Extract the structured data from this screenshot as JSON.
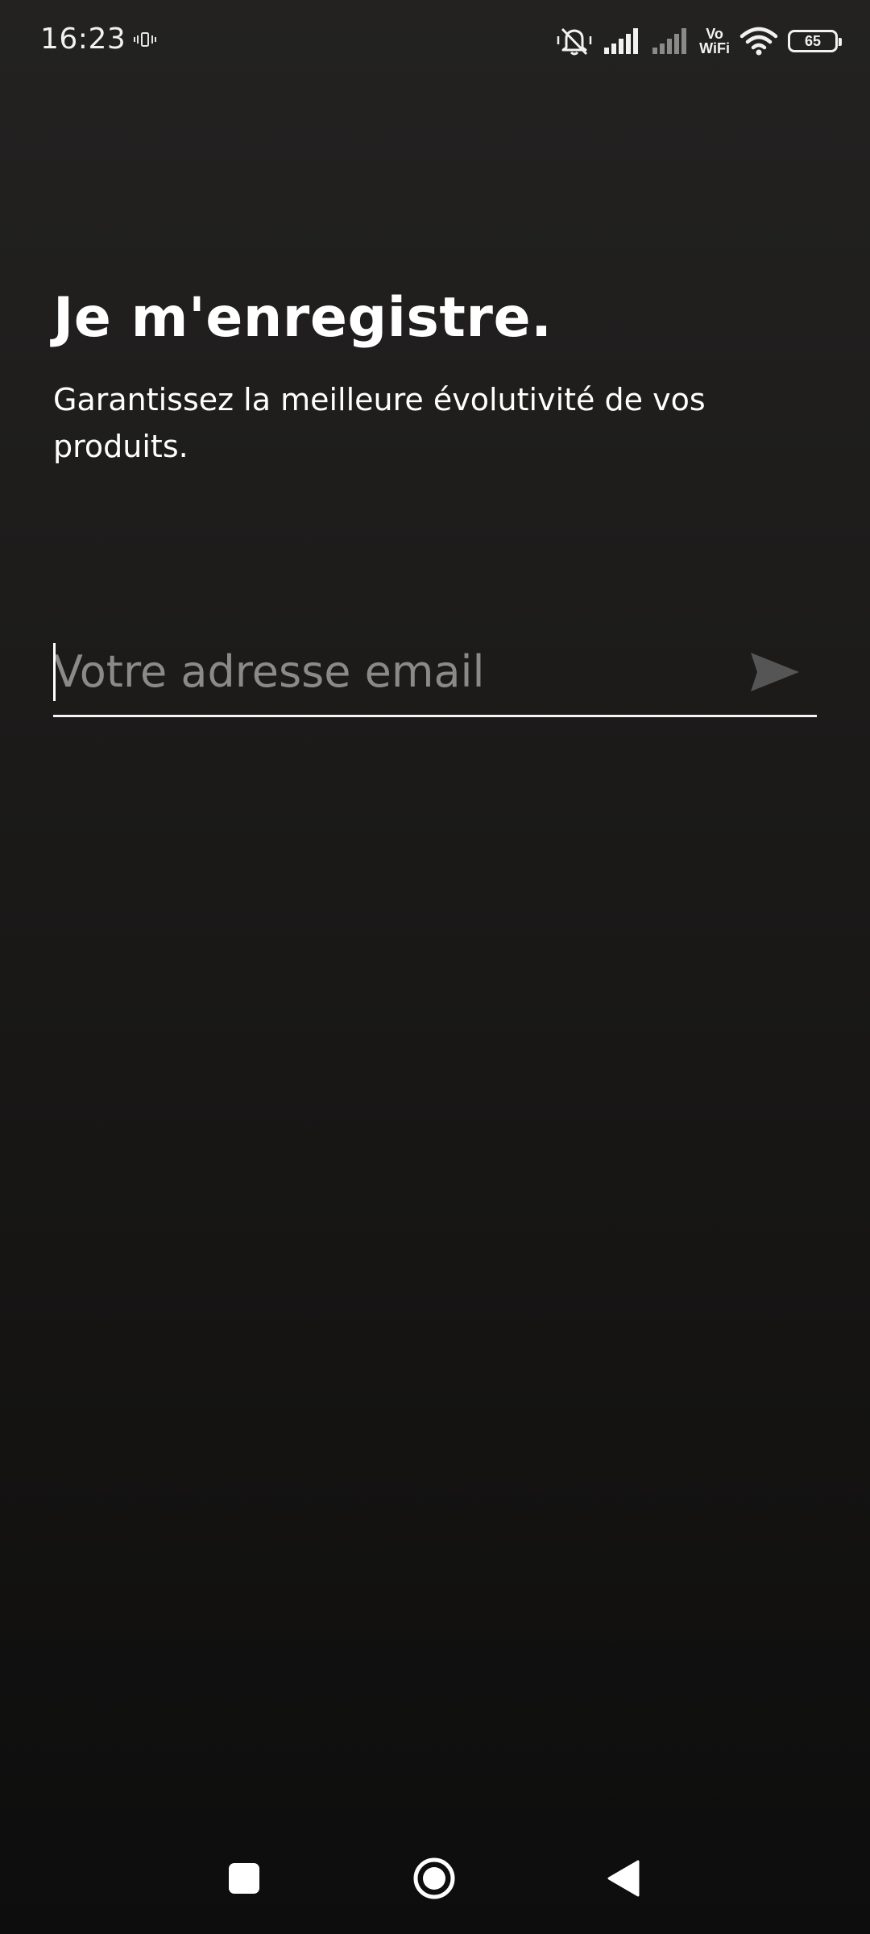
{
  "status_bar": {
    "time": "16:23",
    "battery_level": "65",
    "vowifi_top": "Vo",
    "vowifi_bottom": "WiFi",
    "icons": [
      "vibrate-icon",
      "mute-icon",
      "signal-icon",
      "signal-weak-icon",
      "wifi-icon",
      "battery-icon"
    ]
  },
  "register": {
    "title": "Je m'enregistre.",
    "subtitle": "Garantissez la meilleure évolutivité de vos produits.",
    "email_placeholder": "Votre adresse email",
    "email_value": "",
    "send_icon": "send-icon"
  },
  "nav_bar": {
    "icons": [
      "recents-icon",
      "home-icon",
      "back-icon"
    ]
  },
  "colors": {
    "background_top": "#232221",
    "background_bottom": "#0d0d0d",
    "text": "#ffffff",
    "placeholder": "#8a8a8a",
    "send_icon": "#555555"
  }
}
